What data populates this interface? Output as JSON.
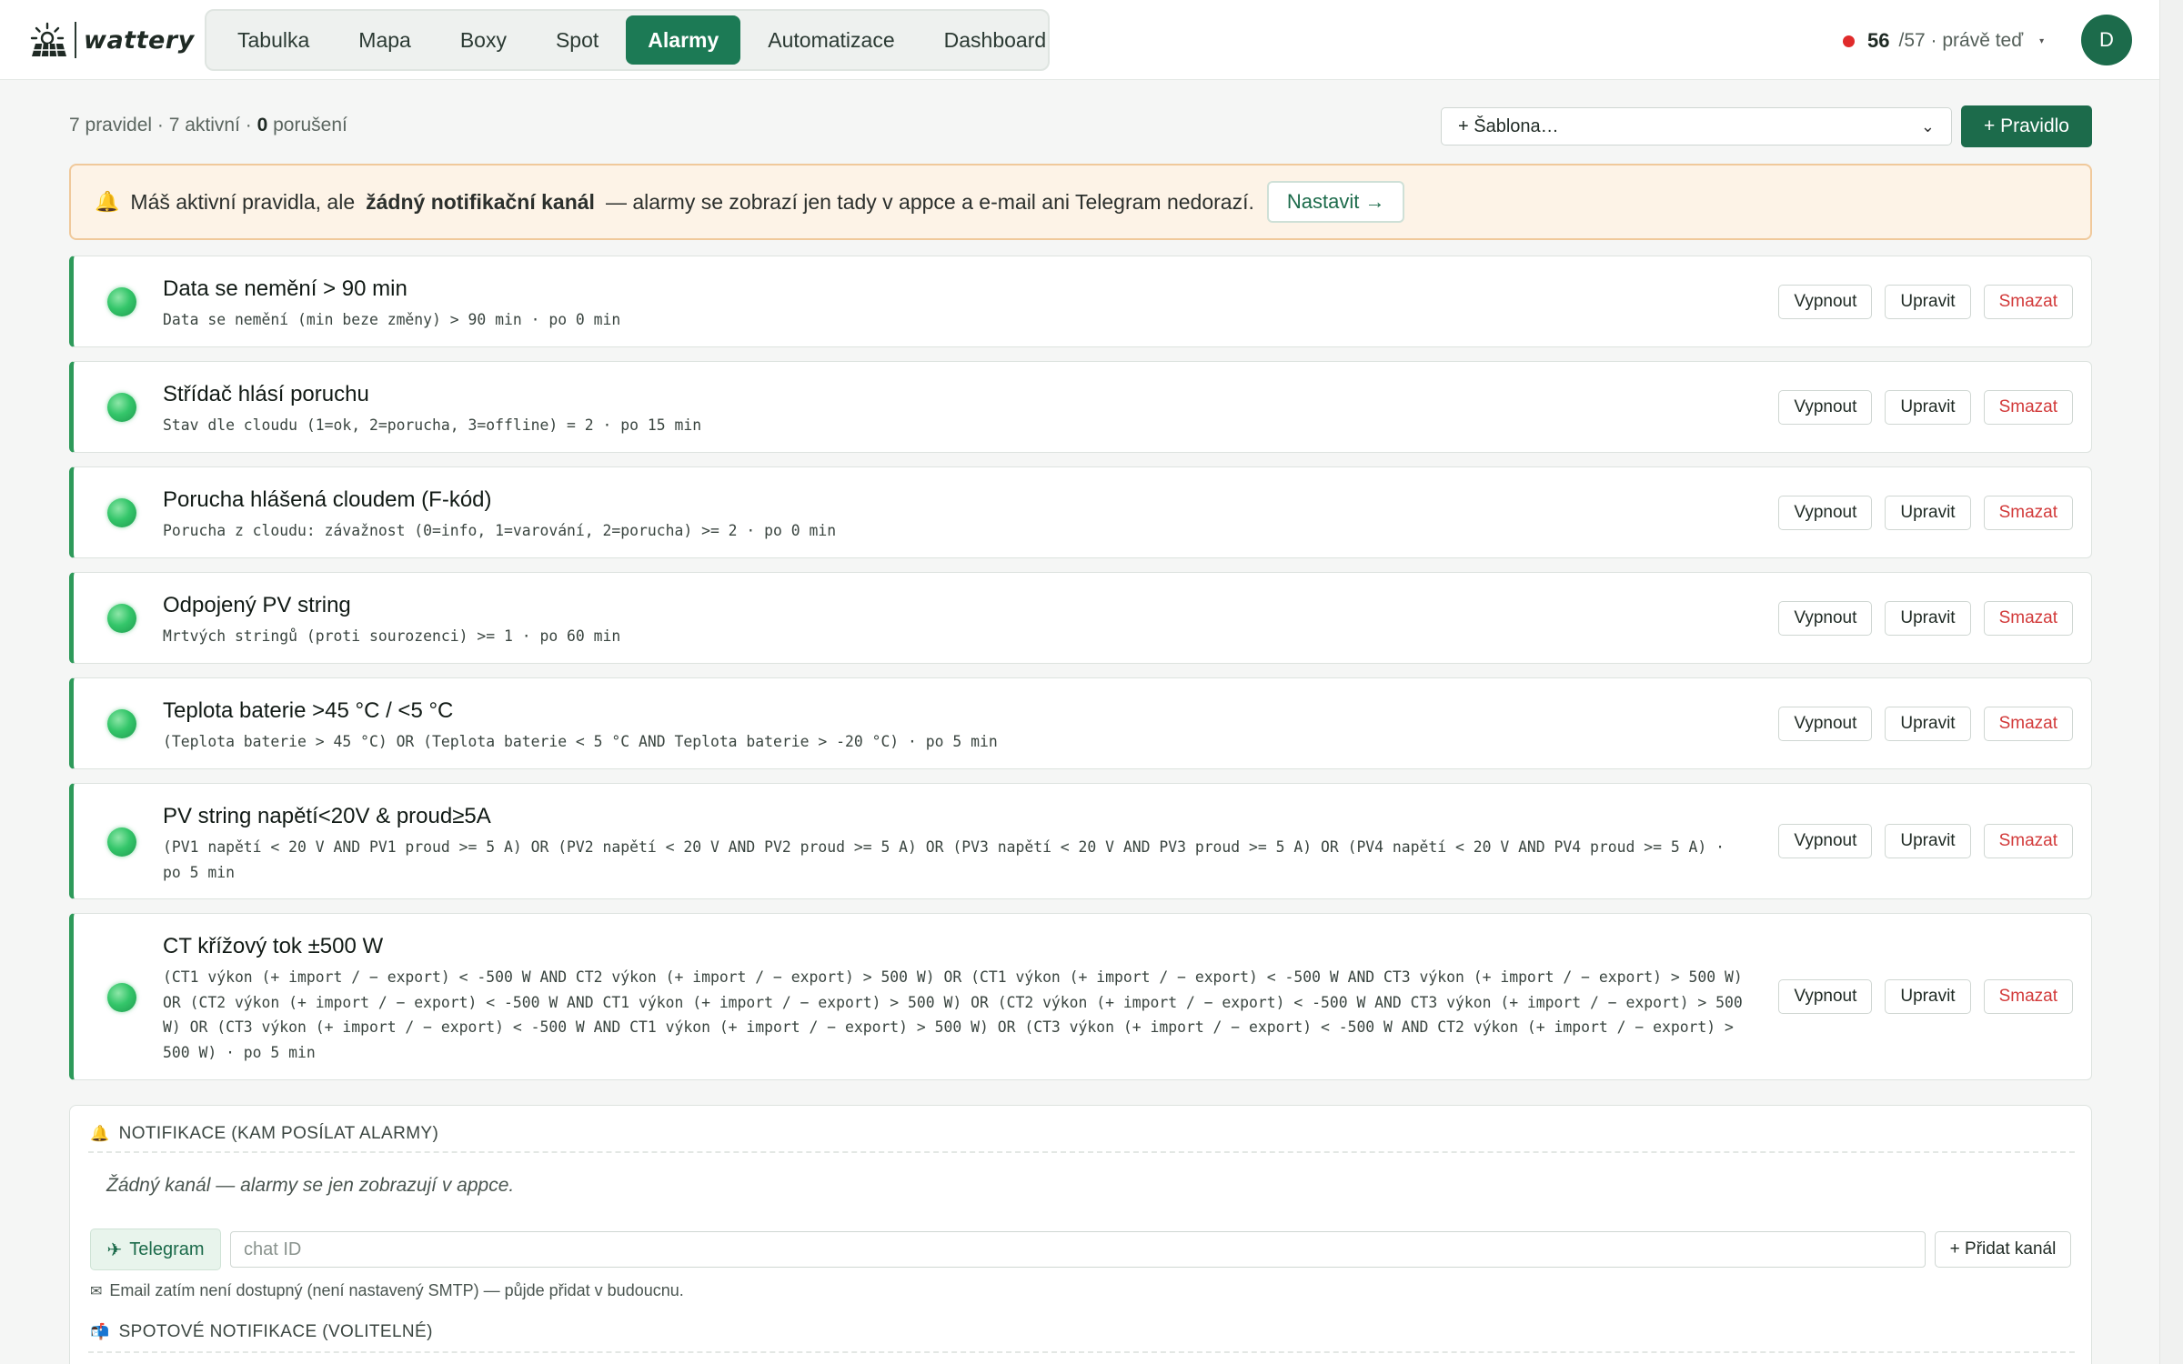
{
  "app": {
    "brand": "wattery"
  },
  "nav": {
    "tabs": [
      {
        "label": "Tabulka"
      },
      {
        "label": "Mapa"
      },
      {
        "label": "Boxy"
      },
      {
        "label": "Spot"
      },
      {
        "label": "Alarmy",
        "active": true
      },
      {
        "label": "Automatizace"
      },
      {
        "label": "Dashboard"
      }
    ]
  },
  "status": {
    "count": "56",
    "rest": "/57 · právě teď",
    "dot_color": "#e02b2b"
  },
  "user": {
    "avatar_initial": "D"
  },
  "summary": {
    "prefix": "7 pravidel · 7 aktivní · ",
    "violations": "0",
    "suffix": " porušení"
  },
  "toolbar": {
    "template_placeholder": "+ Šablona…",
    "add_rule_label": "+ Pravidlo"
  },
  "banner": {
    "text_before": "Máš aktivní pravidla, ale",
    "bold": "žádný notifikační kanál",
    "text_after": "— alarmy se zobrazí jen tady v appce a e-mail ani Telegram nedorazí.",
    "button_label": "Nastavit →"
  },
  "rule_buttons": {
    "disable": "Vypnout",
    "edit": "Upravit",
    "delete": "Smazat"
  },
  "rules": [
    {
      "title": "Data se nemění > 90 min",
      "desc": "Data se nemění (min beze změny) > 90 min · po 0 min",
      "active": true
    },
    {
      "title": "Střídač hlásí poruchu",
      "desc": "Stav dle cloudu (1=ok, 2=porucha, 3=offline) = 2 · po 15 min",
      "active": true
    },
    {
      "title": "Porucha hlášená cloudem (F-kód)",
      "desc": "Porucha z cloudu: závažnost (0=info, 1=varování, 2=porucha) >= 2 · po 0 min",
      "active": true
    },
    {
      "title": "Odpojený PV string",
      "desc": "Mrtvých stringů (proti sourozenci) >= 1 · po 60 min",
      "active": true
    },
    {
      "title": "Teplota baterie >45 °C / <5 °C",
      "desc": "(Teplota baterie > 45 °C) OR (Teplota baterie < 5 °C AND Teplota baterie > -20 °C) · po 5 min",
      "active": true
    },
    {
      "title": "PV string napětí<20V & proud≥5A",
      "desc": "(PV1 napětí < 20 V AND PV1 proud >= 5 A) OR (PV2 napětí < 20 V AND PV2 proud >= 5 A) OR (PV3 napětí < 20 V AND PV3 proud >= 5 A) OR (PV4 napětí < 20 V AND PV4 proud >= 5 A) · po 5 min",
      "active": true
    },
    {
      "title": "CT křížový tok ±500 W",
      "desc": "(CT1 výkon (+ import / − export) < -500 W AND CT2 výkon (+ import / − export) > 500 W) OR (CT1 výkon (+ import / − export) < -500 W AND CT3 výkon (+ import / − export) > 500 W) OR (CT2 výkon (+ import / − export) < -500 W AND CT1 výkon (+ import / − export) > 500 W) OR (CT2 výkon (+ import / − export) < -500 W AND CT3 výkon (+ import / − export) > 500 W) OR (CT3 výkon (+ import / − export) < -500 W AND CT1 výkon (+ import / − export) > 500 W) OR (CT3 výkon (+ import / − export) < -500 W AND CT2 výkon (+ import / − export) > 500 W) · po 5 min",
      "active": true
    }
  ],
  "notifications": {
    "heading": "NOTIFIKACE (KAM POSÍLAT ALARMY)",
    "empty_text": "Žádný kanál — alarmy se jen zobrazují v appce.",
    "telegram_label": "Telegram",
    "chat_placeholder": "chat ID",
    "add_channel_label": "+ Přidat kanál",
    "email_note": "Email zatím není dostupný (není nastavený SMTP) — půjde přidat v budoucnu.",
    "spot_heading": "SPOTOVÉ NOTIFIKACE (VOLITELNÉ)"
  },
  "icons": {
    "bell": "bell-icon",
    "telegram": "send-icon",
    "email": "envelope-icon",
    "spot": "mailbox-icon"
  },
  "colors": {
    "accent": "#1c6b4b",
    "active_tab": "#1c7a55",
    "rule_border": "#2e9a5a",
    "danger": "#d23a3a",
    "banner_bg": "#fdf3e7"
  }
}
